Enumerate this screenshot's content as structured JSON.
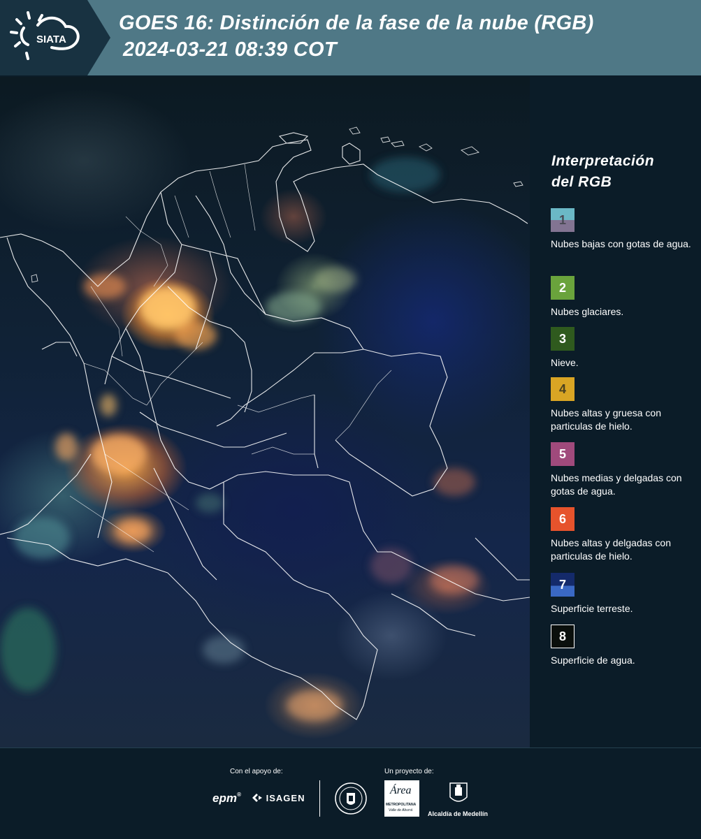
{
  "header": {
    "logo_text": "SIATA",
    "title_line1": "GOES 16: Distinción de la fase de la nube (RGB)",
    "title_line2": "2024-03-21 08:39 COT"
  },
  "legend": {
    "title_line1": "Interpretación",
    "title_line2": "del RGB",
    "items": [
      {
        "number": "1",
        "label": "Nubes bajas con gotas de agua.",
        "color_top": "#6bb8c6",
        "color_bottom": "#827492",
        "number_color": "#4a4a55"
      },
      {
        "number": "2",
        "label": "Nubes glaciares.",
        "color_top": "#6aa33c",
        "color_bottom": "#6aa33c",
        "number_color": "#ffffff"
      },
      {
        "number": "3",
        "label": "Nieve.",
        "color_top": "#2f5a1e",
        "color_bottom": "#2f5a1e",
        "number_color": "#ffffff"
      },
      {
        "number": "4",
        "label": "Nubes altas y gruesa con particulas de hielo.",
        "color_top": "#d9a524",
        "color_bottom": "#d9a524",
        "number_color": "#4a4020"
      },
      {
        "number": "5",
        "label": "Nubes medias y delgadas con gotas de agua.",
        "color_top": "#a04a7c",
        "color_bottom": "#a04a7c",
        "number_color": "#ffffff"
      },
      {
        "number": "6",
        "label": "Nubes altas y delgadas con particulas de hielo.",
        "color_top": "#e6532c",
        "color_bottom": "#e6532c",
        "number_color": "#ffffff"
      },
      {
        "number": "7",
        "label": "Superficie terreste.",
        "color_top": "#142a6a",
        "color_bottom": "#3a68c4",
        "number_color": "#ffffff"
      },
      {
        "number": "8",
        "label": "Superficie de agua.",
        "color_top": "#0a0f0c",
        "color_bottom": "#0a0f0c",
        "number_color": "#ffffff"
      }
    ]
  },
  "footer": {
    "support_label": "Con el apoyo de:",
    "project_label": "Un proyecto de:",
    "brand_epm": "epm",
    "brand_isagen": "ISAGEN",
    "brand_area": "Área",
    "brand_area_sub1": "METROPOLITANA",
    "brand_area_sub2": "Valle de Aburrá",
    "brand_alcaldia": "Alcaldía de Medellín"
  }
}
